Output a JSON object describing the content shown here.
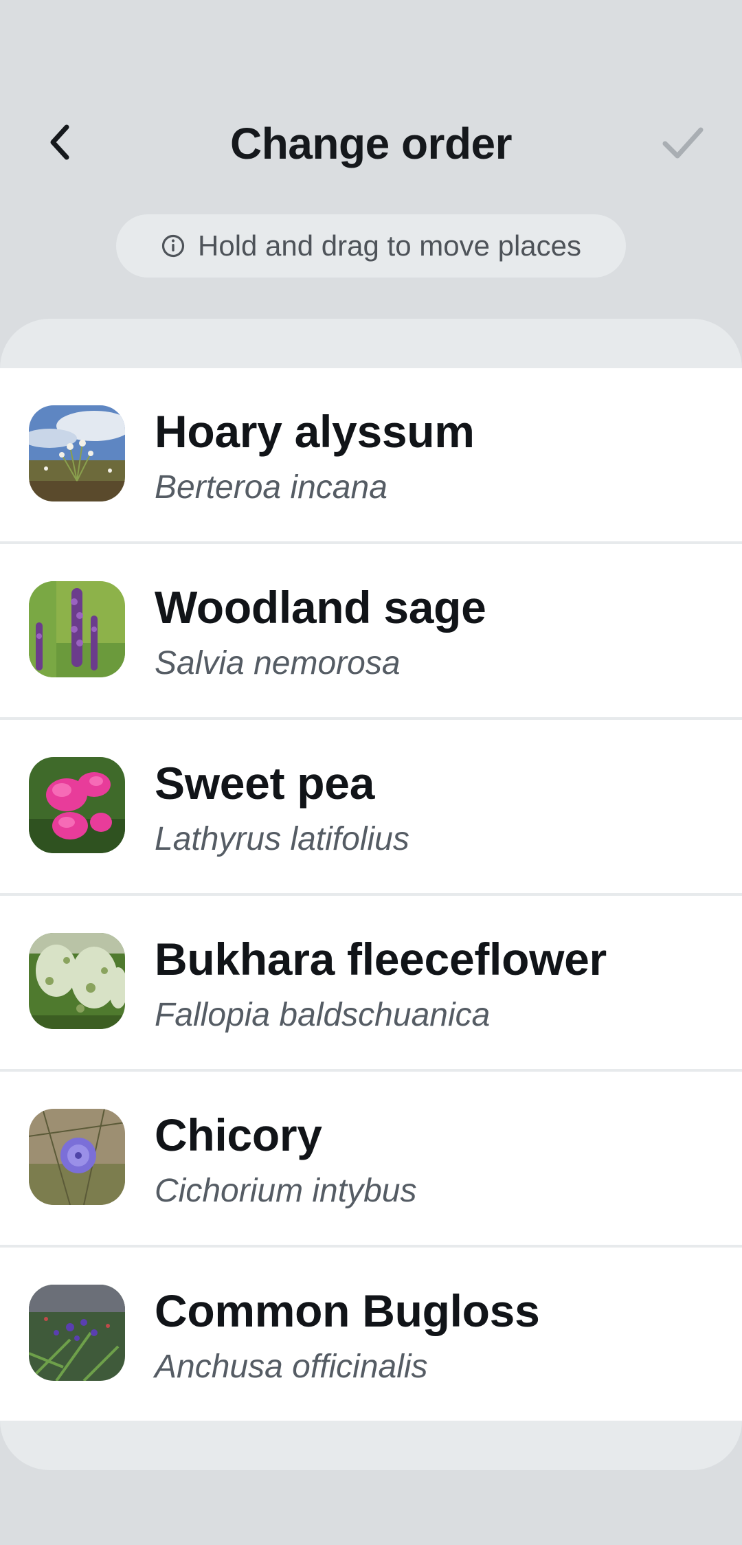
{
  "header": {
    "title": "Change order",
    "back_icon": "chevron-left-icon",
    "confirm_icon": "checkmark-icon"
  },
  "hint": {
    "icon": "info-icon",
    "text": "Hold and drag to move places"
  },
  "plants": [
    {
      "common_name": "Hoary alyssum",
      "scientific_name": "Berteroa incana"
    },
    {
      "common_name": "Woodland sage",
      "scientific_name": "Salvia nemorosa"
    },
    {
      "common_name": "Sweet pea",
      "scientific_name": "Lathyrus latifolius"
    },
    {
      "common_name": "Bukhara fleeceflower",
      "scientific_name": "Fallopia baldschuanica"
    },
    {
      "common_name": "Chicory",
      "scientific_name": "Cichorium intybus"
    },
    {
      "common_name": "Common Bugloss",
      "scientific_name": "Anchusa officinalis"
    }
  ],
  "colors": {
    "background": "#dadde0",
    "sheet": "#e7eaec",
    "row": "#ffffff",
    "title_text": "#15181c",
    "secondary_text": "#555c64",
    "confirm_disabled": "#a9aeb3"
  }
}
